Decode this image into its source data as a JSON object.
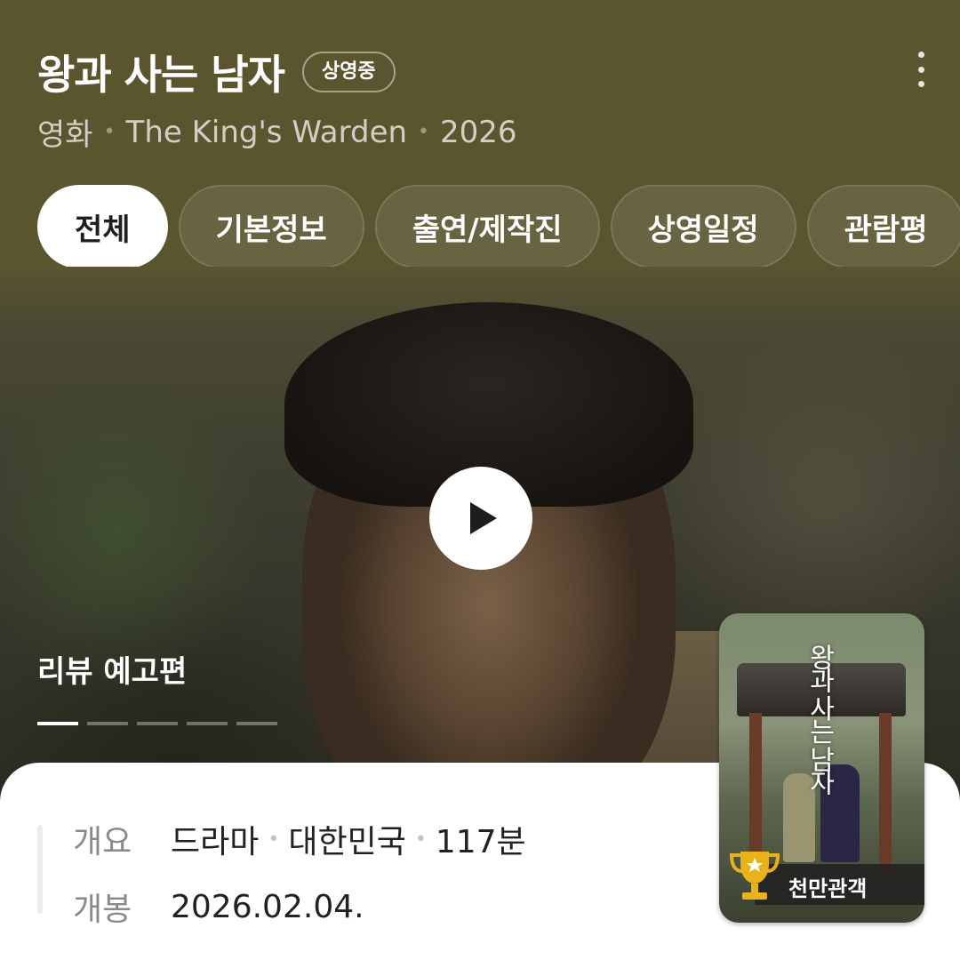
{
  "header": {
    "title": "왕과 사는 남자",
    "status_badge": "상영중",
    "category": "영화",
    "english_title": "The King's Warden",
    "year": "2026"
  },
  "tabs": [
    {
      "label": "전체",
      "active": true
    },
    {
      "label": "기본정보",
      "active": false
    },
    {
      "label": "출연/제작진",
      "active": false
    },
    {
      "label": "상영일정",
      "active": false
    },
    {
      "label": "관람평",
      "active": false
    }
  ],
  "hero": {
    "video_label": "리뷰 예고편",
    "carousel_count": 5,
    "carousel_active_index": 0,
    "play_icon": "play-icon"
  },
  "info": {
    "overview_label": "개요",
    "genre": "드라마",
    "country": "대한민국",
    "runtime": "117분",
    "release_label": "개봉",
    "release_date": "2026.02.04."
  },
  "poster": {
    "title_art": "왕과 사는 남자",
    "badge_text": "천만관객",
    "badge_icon": "trophy-icon"
  },
  "colors": {
    "header_bg": "#5a542f",
    "trophy_gold": "#e8b21a"
  }
}
